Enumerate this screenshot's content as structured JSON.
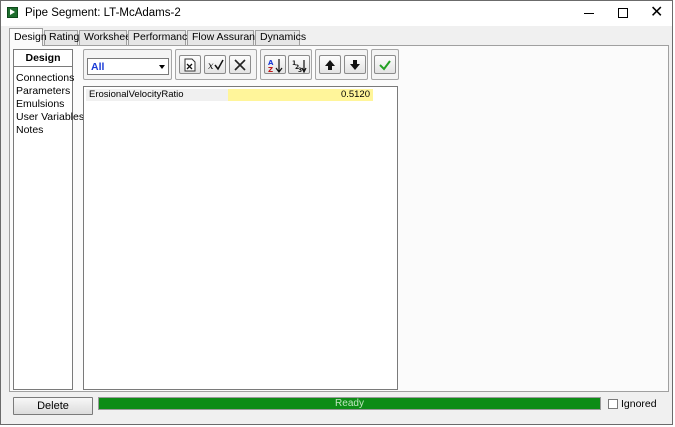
{
  "window": {
    "title": "Pipe Segment: LT-McAdams-2",
    "close_glyph": "✕"
  },
  "tabs": [
    {
      "label": "Design",
      "active": true
    },
    {
      "label": "Rating",
      "active": false
    },
    {
      "label": "Worksheet",
      "active": false
    },
    {
      "label": "Performance",
      "active": false
    },
    {
      "label": "Flow Assurance",
      "active": false
    },
    {
      "label": "Dynamics",
      "active": false
    }
  ],
  "leftnav": {
    "header": "Design",
    "items": [
      "Connections",
      "Parameters",
      "Emulsions",
      "User Variables",
      "Notes"
    ]
  },
  "toolbar": {
    "filter_value": "All",
    "buttons": [
      {
        "icon": "export-excel-icon"
      },
      {
        "icon": "edit-variable-icon"
      },
      {
        "icon": "delete-variable-icon"
      },
      {
        "icon": "sort-alphabetical-icon"
      },
      {
        "icon": "sort-numerical-icon"
      },
      {
        "icon": "move-up-icon"
      },
      {
        "icon": "move-down-icon"
      },
      {
        "icon": "accept-check-icon"
      }
    ]
  },
  "grid": {
    "rows": [
      {
        "name": "ErosionalVelocityRatio",
        "value": "0.5120"
      }
    ]
  },
  "footer": {
    "delete_label": "Delete",
    "status_text": "Ready",
    "ignored_label": "Ignored",
    "ignored_checked": false
  },
  "colors": {
    "status_green": "#0d8c16",
    "value_highlight": "#fff59a",
    "filter_text": "#1a3bd6"
  }
}
